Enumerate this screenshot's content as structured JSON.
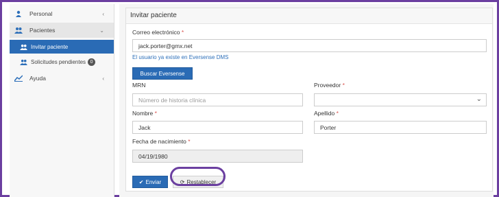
{
  "sidebar": {
    "items": [
      {
        "label": "Personal",
        "chevron": "‹",
        "icon": "person-icon"
      },
      {
        "label": "Pacientes",
        "chevron": "⌄",
        "icon": "users-icon"
      },
      {
        "label": "Ayuda",
        "chevron": "‹",
        "icon": "chart-icon"
      }
    ],
    "subitems": [
      {
        "label": "Invitar paciente",
        "icon": "users-icon"
      },
      {
        "label": "Solicitudes pendientes",
        "icon": "users-icon",
        "badge": "0"
      }
    ]
  },
  "form": {
    "title": "Invitar paciente",
    "email_label": "Correo electrónico",
    "email_value": "jack.porter@gmx.net",
    "email_hint": "El usuario ya existe en Eversense DMS",
    "search_button": "Buscar Eversense",
    "mrn_label": "MRN",
    "mrn_placeholder": "Número de historia clínica",
    "provider_label": "Proveedor",
    "provider_value": "",
    "first_name_label": "Nombre",
    "first_name_value": "Jack",
    "last_name_label": "Apellido",
    "last_name_value": "Porter",
    "dob_label": "Fecha de nacimiento",
    "dob_value": "04/19/1980",
    "submit_button": "Enviar",
    "reset_button": "Restablecer",
    "required_mark": "*"
  },
  "colors": {
    "accent": "#2a6bb5",
    "highlight": "#6b3fa0",
    "required": "#d9534f"
  }
}
